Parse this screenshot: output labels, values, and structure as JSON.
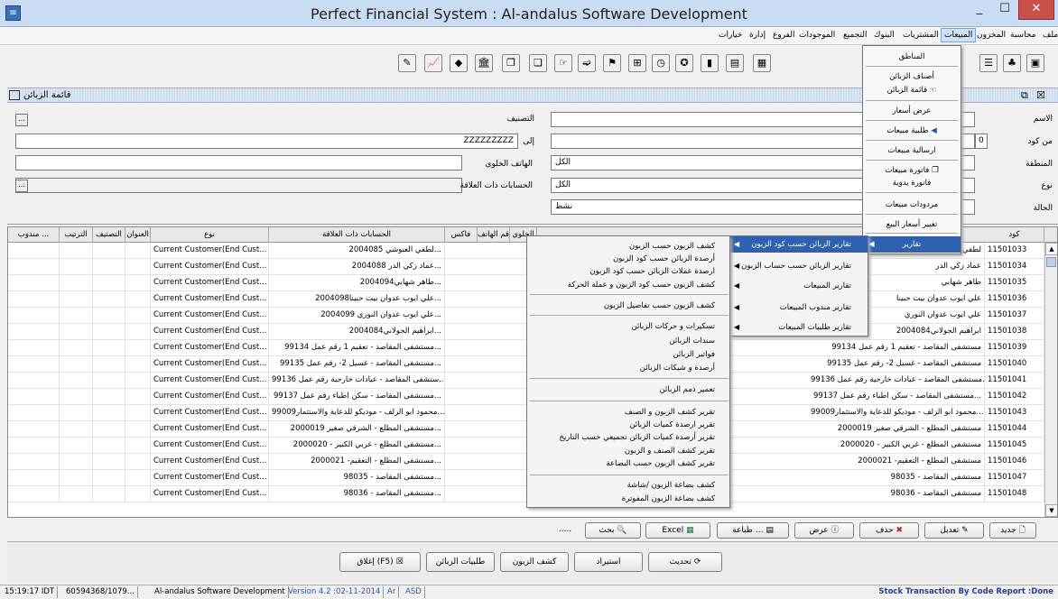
{
  "window": {
    "title": "Perfect Financial System  :  Al-andalus Software Development",
    "min": "_",
    "max": "☐",
    "close": "✕"
  },
  "menubar": [
    "ملف",
    "محاسبة",
    "المخزون",
    "المبيعات",
    "المشتريات",
    "البنوك",
    "التجميع",
    "الموجودات",
    "الفروع",
    "إدارة",
    "خيارات"
  ],
  "frame": {
    "title": "قائمة الزبائن"
  },
  "form": {
    "name_label": "الاسم",
    "category_label": "التصنيف",
    "from_code_label": "من كود",
    "from_code_value": "0",
    "to_label": "إلى",
    "to_value": "ZZZZZZZZZ",
    "region_label": "المنطقة",
    "mobile_label": "الهاتف الخلوي",
    "mobile_value": "الكل",
    "type_label": "نوع",
    "related_accounts_label": "الحسابات ذات العلاقة",
    "related_accounts_value": "الكل",
    "status_label": "الحالة",
    "status_value": "نشط",
    "browse": "..."
  },
  "table": {
    "headers": {
      "code": "كود",
      "type": "نوع",
      "related": "الحسابات ذات العلاقة",
      "phone": "رقم الهاتف",
      "fax": "فاكس",
      "mobile": "الخلوي",
      "address": "العنوان",
      "category": "التصنيف",
      "order": "الترتيب",
      "rep": "مندوب ..."
    },
    "rows": [
      {
        "code": "11501033",
        "name": "لطفي العبوشي",
        "related": "لطفي العبوشي 2004085...",
        "type": "Current Customer(End Cust..."
      },
      {
        "code": "11501034",
        "name": "عماد زكي الدر",
        "related": "عماد زكي الدر 2004088...",
        "type": "Current Customer(End Cust..."
      },
      {
        "code": "11501035",
        "name": "طاهر شهابي",
        "related": "طاهر شهابي2004094...",
        "type": "Current Customer(End Cust..."
      },
      {
        "code": "11501036",
        "name": "علي ايوب عدوان بيت حبينا",
        "related": "علي ايوب عدوان بيت حبينا2004098...",
        "type": "Current Customer(End Cust..."
      },
      {
        "code": "11501037",
        "name": "علي ايوب عدوان النوري",
        "related": "علي ايوب عدوان النوري 2004099...",
        "type": "Current Customer(End Cust..."
      },
      {
        "code": "11501038",
        "name": "ابراهيم الجولاني2004084",
        "related": "ابراهيم الجولاني2004084...",
        "type": "Current Customer(End Cust..."
      },
      {
        "code": "11501039",
        "name": "مستشفى المقاصد - تعقيم 1 رقم عمل 99134",
        "related": "مستشفى المقاصد - تعقيم 1 رقم عمل 99134...",
        "type": "Current Customer(End Cust..."
      },
      {
        "code": "11501040",
        "name": "مستشفى المقاصد - غسيل 2- رقم عمل 99135",
        "related": "مستشفى المقاصد - غسيل 2- رقم عمل 99135...",
        "type": "Current Customer(End Cust..."
      },
      {
        "code": "11501041",
        "name": "مستشفى المقاصد - عيادات خارجية رقم عمل 99136...",
        "related": "ستشفى المقاصد - عيادات خارجية رقم عمل 99136...",
        "type": "Current Customer(End Cust..."
      },
      {
        "code": "11501042",
        "name": "مستشفى المقاصد - سكن اطباء رقم عمل 99137...",
        "related": "مستشفى المقاصد - سكن اطباء رقم عمل 99137...",
        "type": "Current Customer(End Cust..."
      },
      {
        "code": "11501043",
        "name": "محمود ابو الزلف - موديكو للدعاية والاستثمار99009...",
        "related": "محمود ابو الزلف - موديكو للدعاية والاستثمار99009...",
        "type": "Current Customer(End Cust..."
      },
      {
        "code": "11501044",
        "name": "مستشفى المطلع - الشرقي صغير 2000019",
        "related": "مستشفى المطلع - الشرقي صغير 2000019...",
        "type": "Current Customer(End Cust..."
      },
      {
        "code": "11501045",
        "name": "مستشفى المطلع - غربي الكبير - 2000020",
        "related": "مستشفى المطلع - غربي الكبير - 2000020...",
        "type": "Current Customer(End Cust..."
      },
      {
        "code": "11501046",
        "name": "مستشفى المطلع - التعقيم- 2000021",
        "related": "مستشفى المطلع - التعقيم- 2000021...",
        "type": "Current Customer(End Cust..."
      },
      {
        "code": "11501047",
        "name": "مستشفى المقاصد - 98035",
        "related": "مستشفى المقاصد - 98035...",
        "type": "Current Customer(End Cust..."
      },
      {
        "code": "11501048",
        "name": "مستشفى المقاصد - 98036",
        "related": "مستشفى المقاصد - 98036...",
        "type": "Current Customer(End Cust..."
      }
    ]
  },
  "actions": {
    "new": "جديد",
    "edit": "تعديل",
    "delete": "حذف",
    "view": "عرض",
    "print": "طباعة ...",
    "excel": "Excel",
    "search": "بحث",
    "dots": "....."
  },
  "bottom": {
    "refresh": "تحديث",
    "import": "استيراد",
    "customer_statement": "كشف الزبون",
    "customer_requests": "طلبيات الزبائن",
    "close": "إغلاق (F5)"
  },
  "status": {
    "time": "15:19:17 IDT",
    "user": "60594368/1079...",
    "company": "Al-andalus Software Development",
    "version": "Version 4.2 :02-11-2014",
    "lang": "Ar",
    "mode": "ASD",
    "done": "Stock Transaction By Code Report :Done"
  },
  "menu_sales": [
    "المناطق",
    "أصناف الزبائن",
    "قائمة الزبائن",
    "عرض أسعار",
    "طلبية مبيعات",
    "ارسالية مبيعات",
    "فاتورة مبيعات",
    "فاتورة يدوية",
    "مردودات مبيعات",
    "تغيير أسعار البيع",
    "تقارير"
  ],
  "menu_reports": [
    "تقارير الزبائن حسب كود الزبون",
    "تقارير الزبائن حسب حساب الزبون",
    "تقارير المبيعات",
    "تقارير مندوب المبيعات",
    "تقارير طلبيات المبيعات"
  ],
  "menu_sub": [
    "كشف الزبون حسب الزبون",
    "أرصدة الزبائن حسب كود الزبون",
    "ارصدة عملات الزبائن حسب كود الزبون",
    "كشف الزبون حسب كود الزبون و عملة الحركة",
    "كشف الزبون حسب تفاصيل الزبون",
    "تسكيرات و حركات الزبائن",
    "سندات الزبائن",
    "فواتير الزبائن",
    "أرصدة و شيكات الزبائن",
    "تعمير ذمم الزبائن",
    "تقرير كشف الزبون و الصنف",
    "تقرير ارصدة كميات الزبائن",
    "تقرير أرصدة كميات الزبائن تجميعي حسب التاريخ",
    "تقرير كشف الصنف و الزبون",
    "تقرير كشف الزبون حسب البضاعة",
    "كشف بضاعة الزبون /شاشة",
    "كشف بضاعة الزبون المفوترة"
  ]
}
